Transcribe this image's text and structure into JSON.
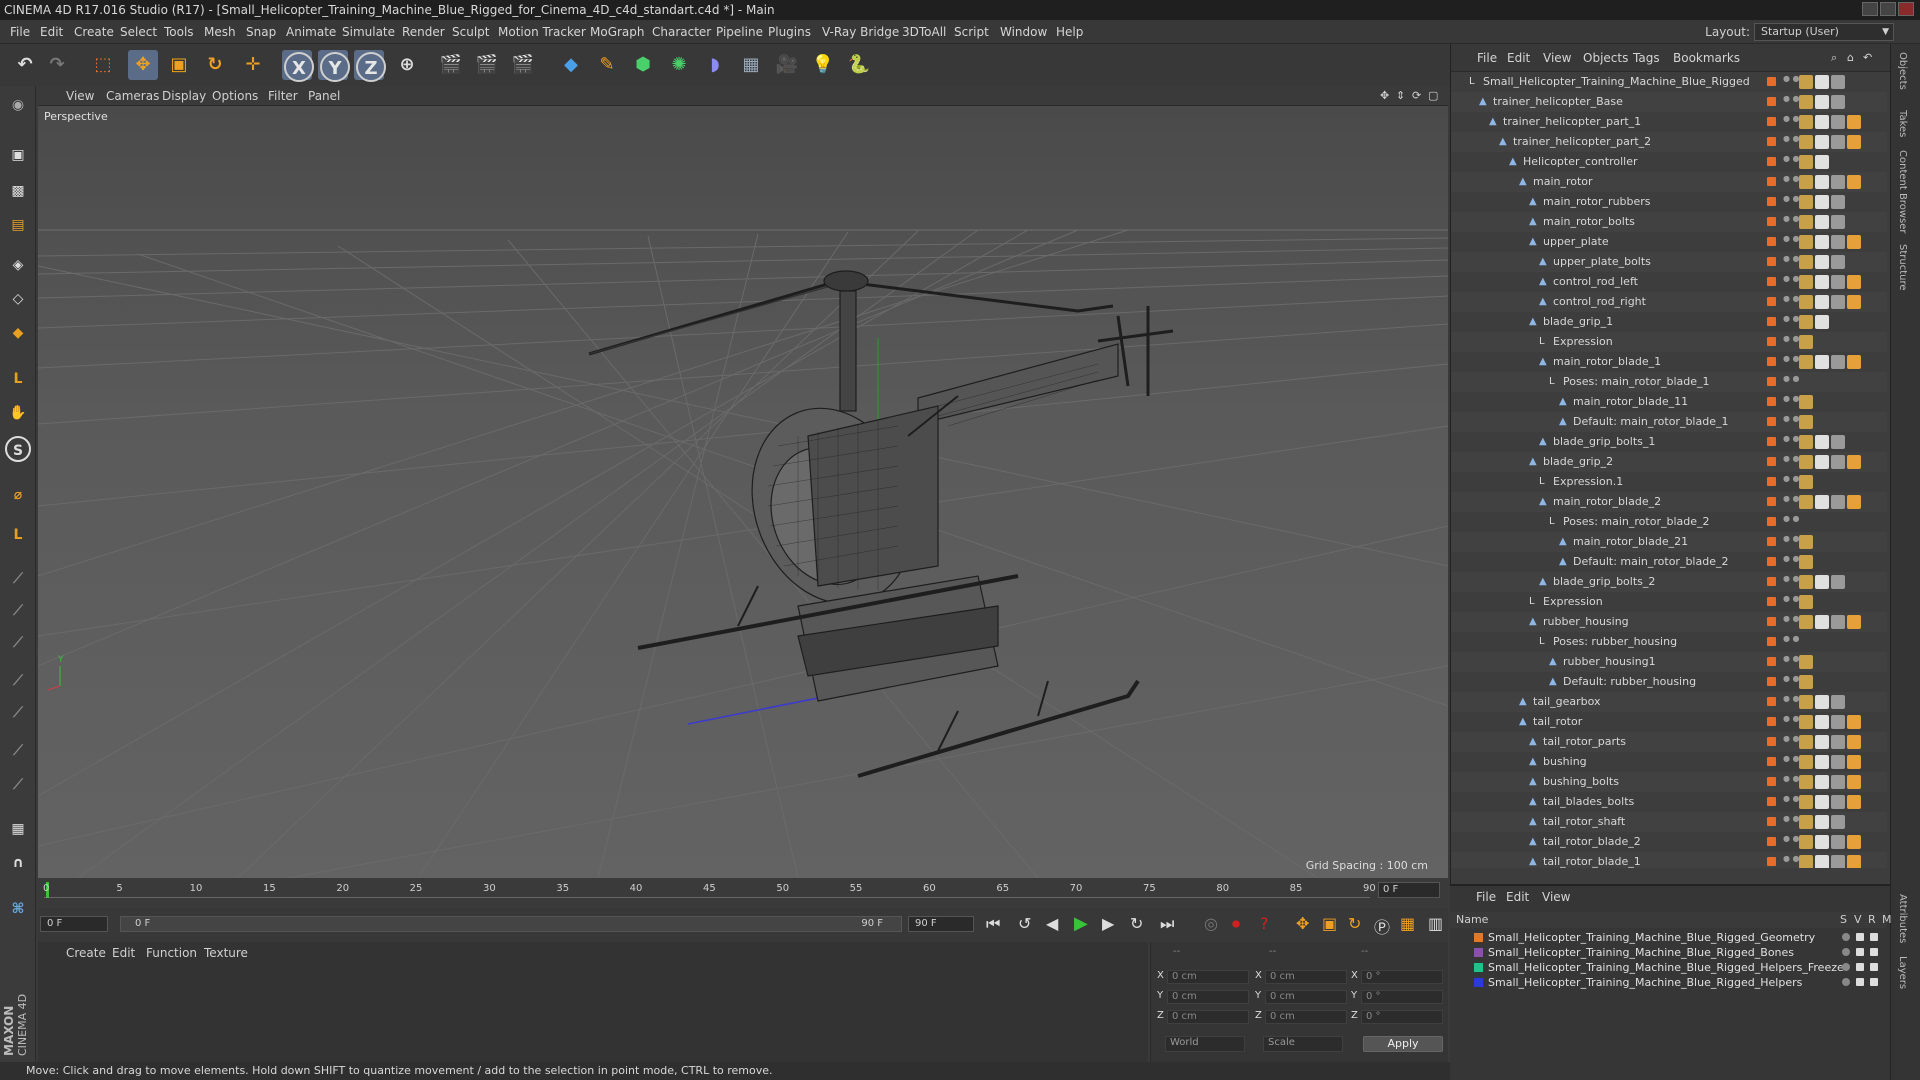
{
  "window": {
    "title": "CINEMA 4D R17.016 Studio (R17) - [Small_Helicopter_Training_Machine_Blue_Rigged_for_Cinema_4D_c4d_standart.c4d *] - Main"
  },
  "menubar": {
    "items": [
      "File",
      "Edit",
      "Create",
      "Select",
      "Tools",
      "Mesh",
      "Snap",
      "Animate",
      "Simulate",
      "Render",
      "Sculpt",
      "Motion Tracker",
      "MoGraph",
      "Character",
      "Pipeline",
      "Plugins",
      "V-Ray Bridge",
      "3DToAll",
      "Script",
      "Window",
      "Help"
    ],
    "layout_label": "Layout:",
    "layout_value": "Startup (User)"
  },
  "toolbar": {
    "axis_x": "X",
    "axis_y": "Y",
    "axis_z": "Z"
  },
  "viewport": {
    "menu": [
      "View",
      "Cameras",
      "Display",
      "Options",
      "Filter",
      "Panel"
    ],
    "camera_label": "Perspective",
    "grid_spacing": "Grid Spacing : 100 cm"
  },
  "timeline": {
    "ticks": [
      "0",
      "5",
      "10",
      "15",
      "20",
      "25",
      "30",
      "35",
      "40",
      "45",
      "50",
      "55",
      "60",
      "65",
      "70",
      "75",
      "80",
      "85",
      "90"
    ],
    "current_frame_box": "0 F",
    "start_frame": "0 F",
    "range_start": "0 F",
    "range_end": "90 F",
    "end_frame": "90 F"
  },
  "material_panel": {
    "menu": [
      "Create",
      "Edit",
      "Function",
      "Texture"
    ]
  },
  "coords": {
    "header": [
      "--",
      "--",
      "--"
    ],
    "rows": [
      {
        "axis": "X",
        "pos": "0 cm",
        "size_axis": "X",
        "size": "0 cm",
        "rot_axis": "X",
        "rot": "0 °"
      },
      {
        "axis": "Y",
        "pos": "0 cm",
        "size_axis": "Y",
        "size": "0 cm",
        "rot_axis": "Y",
        "rot": "0 °"
      },
      {
        "axis": "Z",
        "pos": "0 cm",
        "size_axis": "Z",
        "size": "0 cm",
        "rot_axis": "Z",
        "rot": "0 °"
      }
    ],
    "mode": "World",
    "transform": "Scale",
    "apply": "Apply"
  },
  "status": "Move: Click and drag to move elements. Hold down SHIFT to quantize movement / add to the selection in point mode, CTRL to remove.",
  "object_manager": {
    "menu": [
      "File",
      "Edit",
      "View",
      "Objects",
      "Tags",
      "Bookmarks"
    ],
    "tree": [
      {
        "name": "Small_Helicopter_Training_Machine_Blue_Rigged",
        "depth": 0,
        "kind": "null",
        "tags": 3
      },
      {
        "name": "trainer_helicopter_Base",
        "depth": 1,
        "kind": "bone",
        "tags": 3
      },
      {
        "name": "trainer_helicopter_part_1",
        "depth": 2,
        "kind": "bone",
        "tags": 4
      },
      {
        "name": "trainer_helicopter_part_2",
        "depth": 3,
        "kind": "bone",
        "tags": 4
      },
      {
        "name": "Helicopter_controller",
        "depth": 4,
        "kind": "bone",
        "tags": 2
      },
      {
        "name": "main_rotor",
        "depth": 5,
        "kind": "bone",
        "tags": 4
      },
      {
        "name": "main_rotor_rubbers",
        "depth": 6,
        "kind": "bone",
        "tags": 3
      },
      {
        "name": "main_rotor_bolts",
        "depth": 6,
        "kind": "bone",
        "tags": 3
      },
      {
        "name": "upper_plate",
        "depth": 6,
        "kind": "bone",
        "tags": 4
      },
      {
        "name": "upper_plate_bolts",
        "depth": 7,
        "kind": "bone",
        "tags": 3
      },
      {
        "name": "control_rod_left",
        "depth": 7,
        "kind": "bone",
        "tags": 4
      },
      {
        "name": "control_rod_right",
        "depth": 7,
        "kind": "bone",
        "tags": 4
      },
      {
        "name": "blade_grip_1",
        "depth": 6,
        "kind": "bone",
        "tags": 2
      },
      {
        "name": "Expression",
        "depth": 7,
        "kind": "null",
        "tags": 1
      },
      {
        "name": "main_rotor_blade_1",
        "depth": 7,
        "kind": "bone",
        "tags": 4
      },
      {
        "name": "Poses: main_rotor_blade_1",
        "depth": 8,
        "kind": "null",
        "tags": 0
      },
      {
        "name": "main_rotor_blade_11",
        "depth": 9,
        "kind": "bone",
        "tags": 1
      },
      {
        "name": "Default: main_rotor_blade_1",
        "depth": 9,
        "kind": "bone",
        "tags": 1
      },
      {
        "name": "blade_grip_bolts_1",
        "depth": 7,
        "kind": "bone",
        "tags": 3
      },
      {
        "name": "blade_grip_2",
        "depth": 6,
        "kind": "bone",
        "tags": 4
      },
      {
        "name": "Expression.1",
        "depth": 7,
        "kind": "null",
        "tags": 1
      },
      {
        "name": "main_rotor_blade_2",
        "depth": 7,
        "kind": "bone",
        "tags": 4
      },
      {
        "name": "Poses: main_rotor_blade_2",
        "depth": 8,
        "kind": "null",
        "tags": 0
      },
      {
        "name": "main_rotor_blade_21",
        "depth": 9,
        "kind": "bone",
        "tags": 1
      },
      {
        "name": "Default: main_rotor_blade_2",
        "depth": 9,
        "kind": "bone",
        "tags": 1
      },
      {
        "name": "blade_grip_bolts_2",
        "depth": 7,
        "kind": "bone",
        "tags": 3
      },
      {
        "name": "Expression",
        "depth": 6,
        "kind": "null",
        "tags": 1
      },
      {
        "name": "rubber_housing",
        "depth": 6,
        "kind": "bone",
        "tags": 4
      },
      {
        "name": "Poses: rubber_housing",
        "depth": 7,
        "kind": "null",
        "tags": 0
      },
      {
        "name": "rubber_housing1",
        "depth": 8,
        "kind": "bone",
        "tags": 1
      },
      {
        "name": "Default: rubber_housing",
        "depth": 8,
        "kind": "bone",
        "tags": 1
      },
      {
        "name": "tail_gearbox",
        "depth": 5,
        "kind": "bone",
        "tags": 3
      },
      {
        "name": "tail_rotor",
        "depth": 5,
        "kind": "bone",
        "tags": 4
      },
      {
        "name": "tail_rotor_parts",
        "depth": 6,
        "kind": "bone",
        "tags": 4
      },
      {
        "name": "bushing",
        "depth": 6,
        "kind": "bone",
        "tags": 4
      },
      {
        "name": "bushing_bolts",
        "depth": 6,
        "kind": "bone",
        "tags": 4
      },
      {
        "name": "tail_blades_bolts",
        "depth": 6,
        "kind": "bone",
        "tags": 4
      },
      {
        "name": "tail_rotor_shaft",
        "depth": 6,
        "kind": "bone",
        "tags": 3
      },
      {
        "name": "tail_rotor_blade_2",
        "depth": 6,
        "kind": "bone",
        "tags": 4
      },
      {
        "name": "tail_rotor_blade_1",
        "depth": 6,
        "kind": "bone",
        "tags": 4
      }
    ]
  },
  "right_tabs": [
    "Objects",
    "Takes",
    "Content Browser",
    "Structure",
    "Attributes",
    "Layers"
  ],
  "layer_manager": {
    "menu": [
      "File",
      "Edit",
      "View"
    ],
    "col_name": "Name",
    "col_s": "S",
    "col_v": "V",
    "col_r": "R",
    "col_m": "M",
    "layers": [
      {
        "name": "Small_Helicopter_Training_Machine_Blue_Rigged_Geometry",
        "color": "#e07a2a"
      },
      {
        "name": "Small_Helicopter_Training_Machine_Blue_Rigged_Bones",
        "color": "#8a4fb0"
      },
      {
        "name": "Small_Helicopter_Training_Machine_Blue_Rigged_Helpers_Freeze",
        "color": "#22c08a"
      },
      {
        "name": "Small_Helicopter_Training_Machine_Blue_Rigged_Helpers",
        "color": "#2a3adc"
      }
    ]
  },
  "branding": {
    "maxon": "MAXON",
    "product": "CINEMA 4D"
  },
  "colors": {
    "accent_orange": "#e86d2a",
    "timeline_green": "#3ac23a",
    "play_green": "#3ac23a",
    "stop_red": "#d02020"
  }
}
